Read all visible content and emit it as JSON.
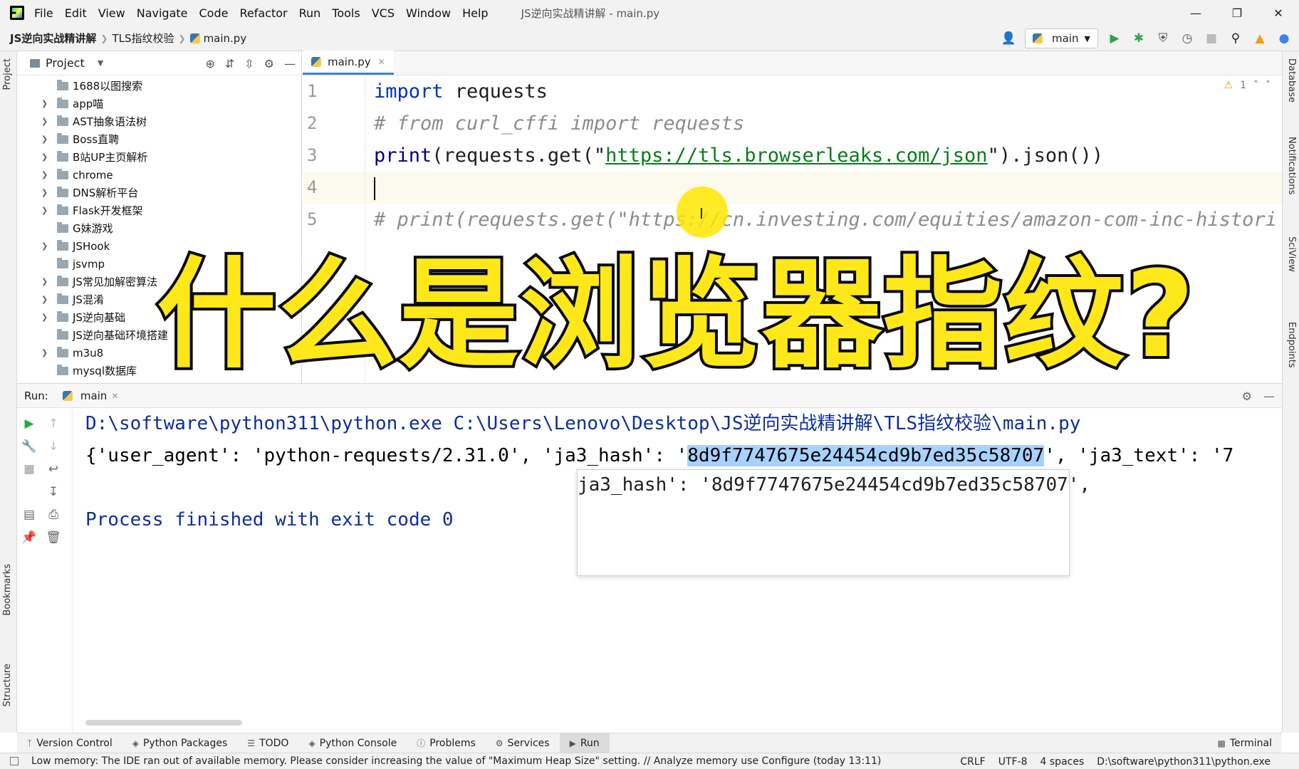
{
  "menu": {
    "items": [
      "File",
      "Edit",
      "View",
      "Navigate",
      "Code",
      "Refactor",
      "Run",
      "Tools",
      "VCS",
      "Window",
      "Help"
    ],
    "window_title": "JS逆向实战精讲解 - main.py"
  },
  "breadcrumb": {
    "project": "JS逆向实战精讲解",
    "folder": "TLS指纹校验",
    "file": "main.py"
  },
  "run_config": {
    "label": "main"
  },
  "project_panel": {
    "title": "Project",
    "items": [
      {
        "label": "1688以图搜索",
        "expandable": false
      },
      {
        "label": "app喵",
        "expandable": true
      },
      {
        "label": "AST抽象语法树",
        "expandable": true
      },
      {
        "label": "Boss直聘",
        "expandable": true
      },
      {
        "label": "B站UP主页解析",
        "expandable": true
      },
      {
        "label": "chrome",
        "expandable": true
      },
      {
        "label": "DNS解析平台",
        "expandable": true
      },
      {
        "label": "Flask开发框架",
        "expandable": true
      },
      {
        "label": "G妹游戏",
        "expandable": false
      },
      {
        "label": "JSHook",
        "expandable": true
      },
      {
        "label": "jsvmp",
        "expandable": false
      },
      {
        "label": "JS常见加解密算法",
        "expandable": true
      },
      {
        "label": "JS混淆",
        "expandable": true
      },
      {
        "label": "JS逆向基础",
        "expandable": true
      },
      {
        "label": "JS逆向基础环境搭建",
        "expandable": false
      },
      {
        "label": "m3u8",
        "expandable": true
      },
      {
        "label": "mysql数据库",
        "expandable": false
      }
    ]
  },
  "editor": {
    "tab_label": "main.py",
    "inspection_count": "1",
    "line_numbers": [
      "1",
      "2",
      "3",
      "4",
      "5"
    ],
    "lines": {
      "l1_kw": "import",
      "l1_rest": " requests",
      "l2": "# from curl_cffi import requests",
      "l3_fn": "print",
      "l3_a": "(requests.get(\"",
      "l3_url": "https://tls.browserleaks.com/json",
      "l3_b": "\").json())",
      "l5": "# print(requests.get(\"https://cn.investing.com/equities/amazon-com-inc-histori"
    }
  },
  "overlay": {
    "title": "什么是浏览器指纹?"
  },
  "run_panel": {
    "label": "Run:",
    "tab_label": "main",
    "console": {
      "cmd": "D:\\software\\python311\\python.exe C:\\Users\\Lenovo\\Desktop\\JS逆向实战精讲解\\TLS指纹校验\\main.py",
      "out_a": "{'user_agent': 'python-requests/2.31.0', 'ja3_hash': '",
      "out_sel": "8d9f7747675e24454cd9b7ed35c58707",
      "out_b": "', 'ja3_text': '7",
      "exit": "Process finished with exit code 0"
    },
    "popup_text": "ja3_hash': '8d9f7747675e24454cd9b7ed35c58707',"
  },
  "bottom_tabs": {
    "items": [
      "Version Control",
      "Python Packages",
      "TODO",
      "Python Console",
      "Problems",
      "Services",
      "Run"
    ],
    "terminal": "Terminal"
  },
  "left_strip": {
    "project": "Project",
    "bookmarks": "Bookmarks",
    "structure": "Structure"
  },
  "right_strip": {
    "database": "Database",
    "notifications": "Notifications",
    "sciview": "SciView",
    "endpoints": "Endpoints"
  },
  "statusbar": {
    "message": "Low memory: The IDE ran out of available memory. Please consider increasing the value of \"Maximum Heap Size\" setting. // Analyze memory use   Configure (today 13:11)",
    "line_sep": "CRLF",
    "encoding": "UTF-8",
    "indent": "4 spaces",
    "interpreter": "D:\\software\\python311\\python.exe"
  },
  "colors": {
    "keyword": "#0033b3",
    "comment": "#8c8c8c",
    "string": "#067d17",
    "selection": "#a6d2ff",
    "overlay_fill": "#ffe81a"
  }
}
